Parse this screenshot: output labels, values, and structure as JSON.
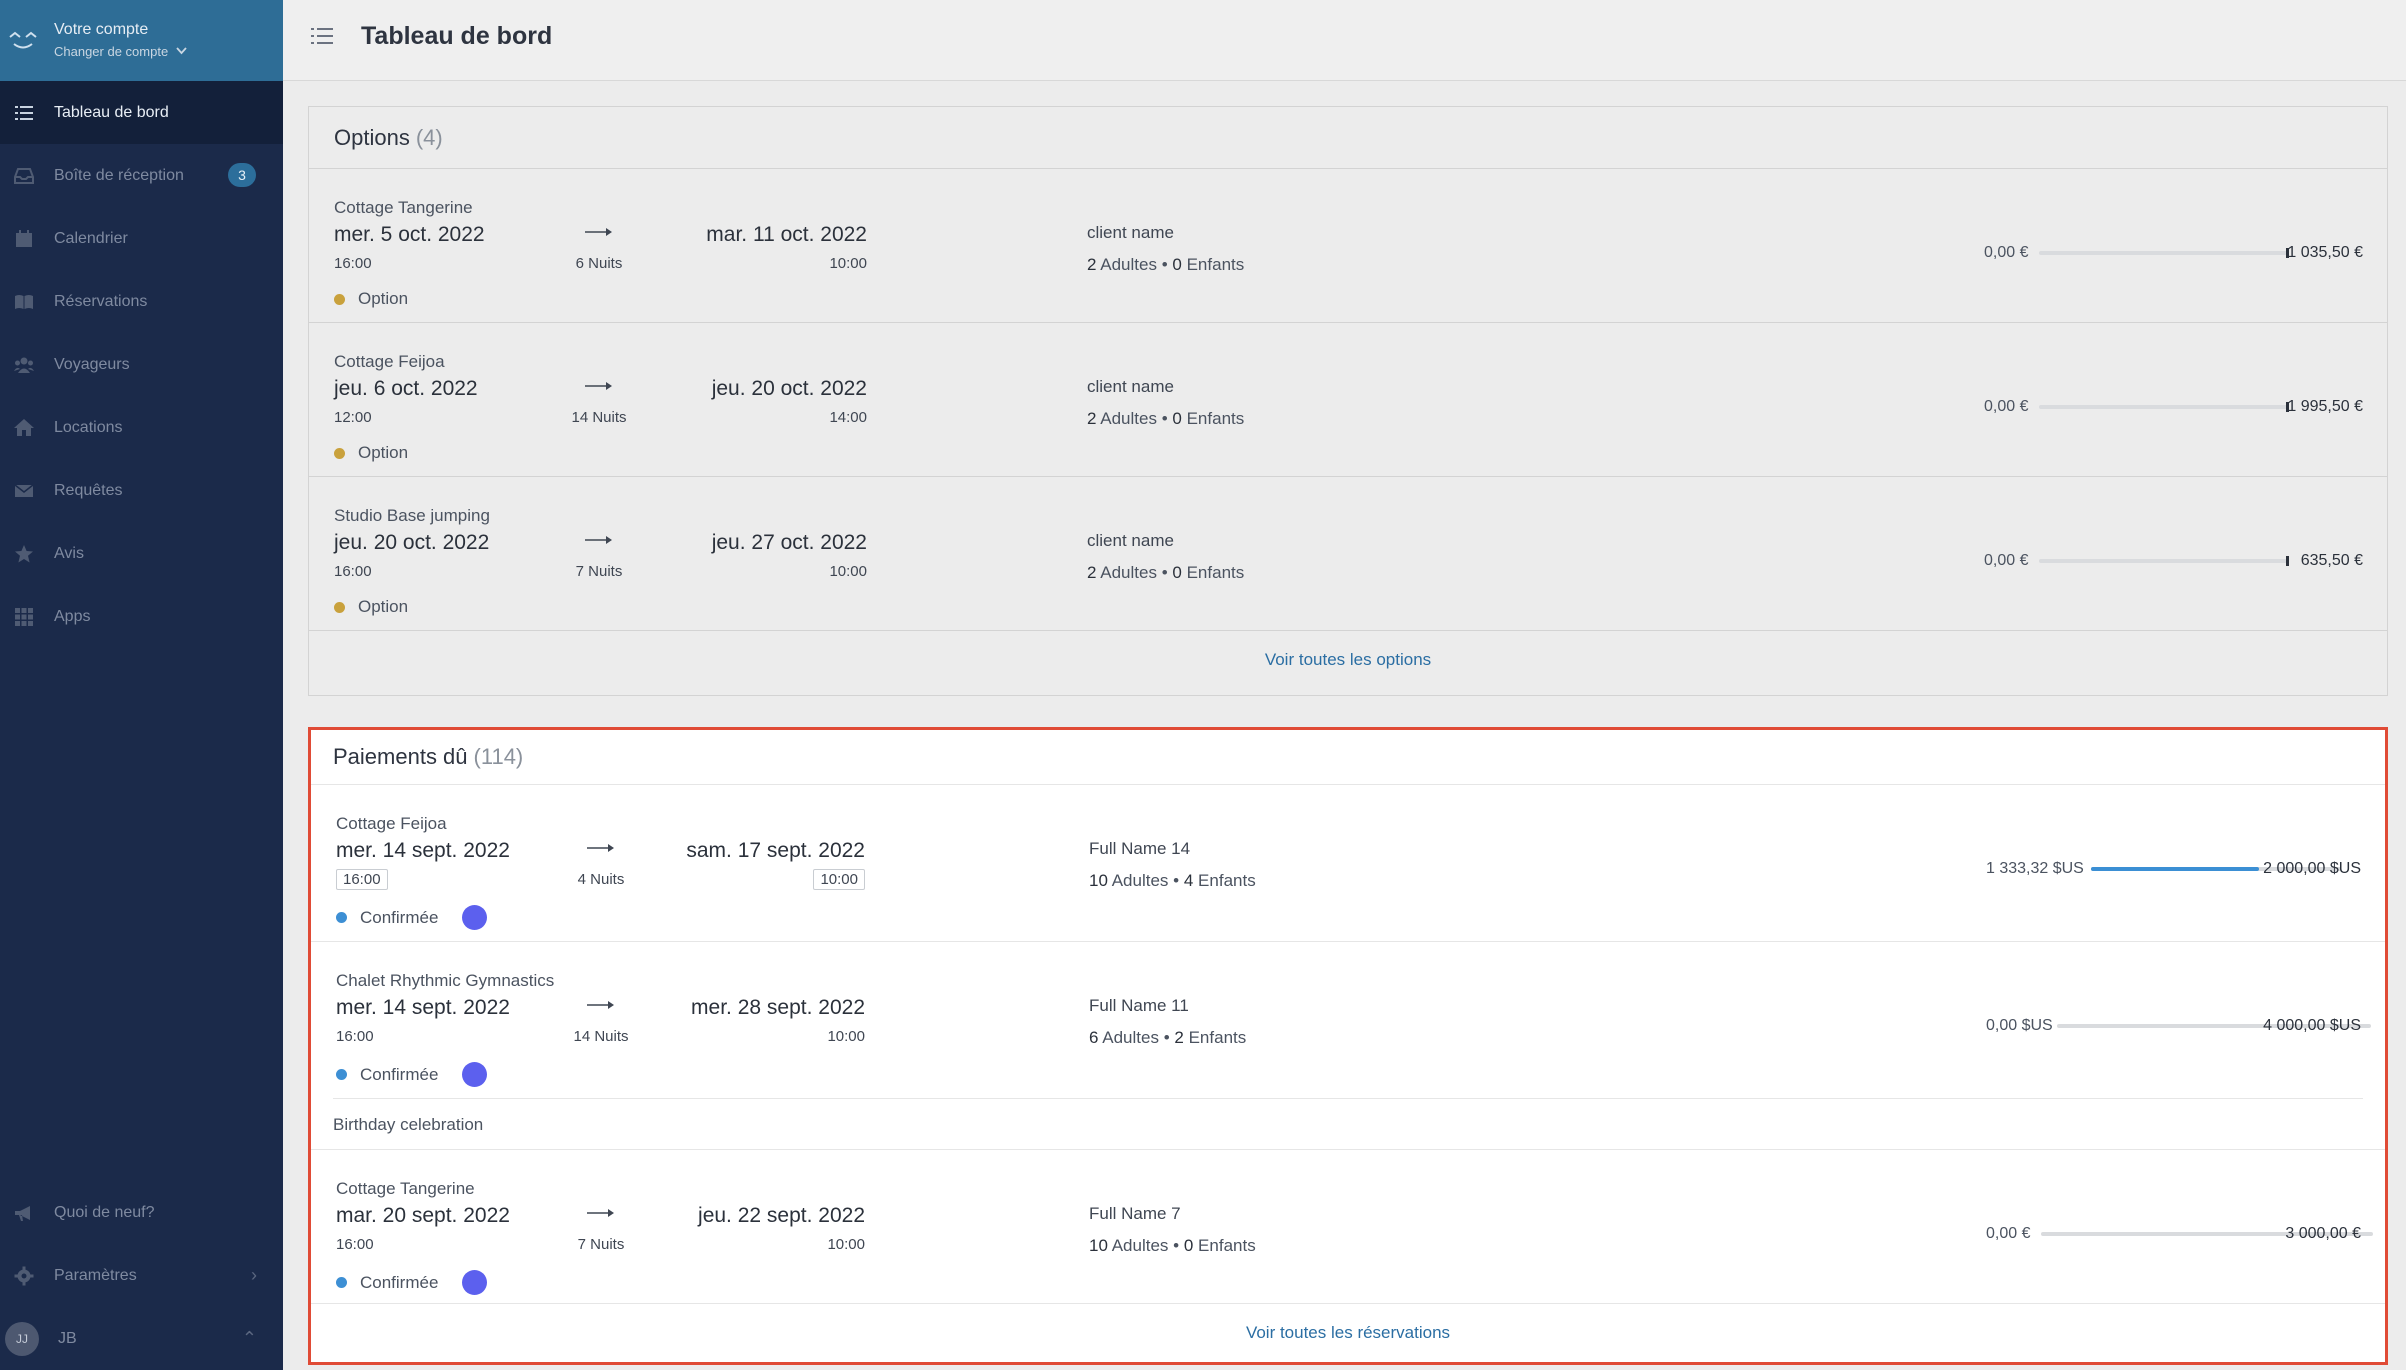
{
  "sidebar": {
    "account_title": "Votre compte",
    "account_switch": "Changer de compte",
    "items": [
      {
        "label": "Tableau de bord",
        "icon": "list-icon"
      },
      {
        "label": "Boîte de réception",
        "icon": "inbox-icon",
        "badge": "3"
      },
      {
        "label": "Calendrier",
        "icon": "calendar-icon"
      },
      {
        "label": "Réservations",
        "icon": "book-icon"
      },
      {
        "label": "Voyageurs",
        "icon": "users-icon"
      },
      {
        "label": "Locations",
        "icon": "home-icon"
      },
      {
        "label": "Requêtes",
        "icon": "envelope-icon"
      },
      {
        "label": "Avis",
        "icon": "star-icon"
      },
      {
        "label": "Apps",
        "icon": "grid-icon"
      }
    ],
    "bottom": [
      {
        "label": "Quoi de neuf?",
        "icon": "megaphone-icon"
      },
      {
        "label": "Paramètres",
        "icon": "gear-icon"
      },
      {
        "label": "JB",
        "avatar": "JJ"
      }
    ]
  },
  "header": {
    "title": "Tableau de bord"
  },
  "options": {
    "title": "Options",
    "count": "(4)",
    "rows": [
      {
        "property": "Cottage Tangerine",
        "start_date": "mer. 5 oct. 2022",
        "start_time": "16:00",
        "nights": "6 Nuits",
        "end_date": "mar. 11 oct. 2022",
        "end_time": "10:00",
        "client": "client name",
        "adults": "2",
        "adults_label": "Adultes",
        "children": "0",
        "children_label": "Enfants",
        "status": "Option",
        "paid": "0,00 €",
        "total": "1 035,50 €",
        "progress": 0
      },
      {
        "property": "Cottage Feijoa",
        "start_date": "jeu. 6 oct. 2022",
        "start_time": "12:00",
        "nights": "14 Nuits",
        "end_date": "jeu. 20 oct. 2022",
        "end_time": "14:00",
        "client": "client name",
        "adults": "2",
        "adults_label": "Adultes",
        "children": "0",
        "children_label": "Enfants",
        "status": "Option",
        "paid": "0,00 €",
        "total": "1 995,50 €",
        "progress": 0
      },
      {
        "property": "Studio Base jumping",
        "start_date": "jeu. 20 oct. 2022",
        "start_time": "16:00",
        "nights": "7 Nuits",
        "end_date": "jeu. 27 oct. 2022",
        "end_time": "10:00",
        "client": "client name",
        "adults": "2",
        "adults_label": "Adultes",
        "children": "0",
        "children_label": "Enfants",
        "status": "Option",
        "paid": "0,00 €",
        "total": "635,50 €",
        "progress": 0
      }
    ],
    "footer_link": "Voir toutes les options"
  },
  "payments": {
    "title": "Paiements dû",
    "count": "(114)",
    "rows": [
      {
        "property": "Cottage Feijoa",
        "start_date": "mer. 14 sept. 2022",
        "start_time": "16:00",
        "nights": "4 Nuits",
        "end_date": "sam. 17 sept. 2022",
        "end_time": "10:00",
        "client": "Full Name 14",
        "adults": "10",
        "adults_label": "Adultes",
        "children": "4",
        "children_label": "Enfants",
        "status": "Confirmée",
        "paid": "1 333,32 $US",
        "total": "2 000,00 $US",
        "progress": 0.67
      },
      {
        "property": "Chalet Rhythmic Gymnastics",
        "start_date": "mer. 14 sept. 2022",
        "start_time": "16:00",
        "nights": "14 Nuits",
        "end_date": "mer. 28 sept. 2022",
        "end_time": "10:00",
        "client": "Full Name 11",
        "adults": "6",
        "adults_label": "Adultes",
        "children": "2",
        "children_label": "Enfants",
        "status": "Confirmée",
        "paid": "0,00 $US",
        "total": "4 000,00 $US",
        "progress": 0,
        "note": "Birthday celebration"
      },
      {
        "property": "Cottage Tangerine",
        "start_date": "mar. 20 sept. 2022",
        "start_time": "16:00",
        "nights": "7 Nuits",
        "end_date": "jeu. 22 sept. 2022",
        "end_time": "10:00",
        "client": "Full Name 7",
        "adults": "10",
        "adults_label": "Adultes",
        "children": "0",
        "children_label": "Enfants",
        "status": "Confirmée",
        "paid": "0,00 €",
        "total": "3 000,00 €",
        "progress": 0
      }
    ],
    "footer_link": "Voir toutes les réservations"
  },
  "colors": {
    "sidebar": "#1b2a4a",
    "account_bar": "#2e6d96",
    "highlight_border": "#e04b36",
    "option_dot": "#c9a13c",
    "confirmed_dot": "#3d8fd4",
    "guest_dot": "#5c60ee"
  }
}
